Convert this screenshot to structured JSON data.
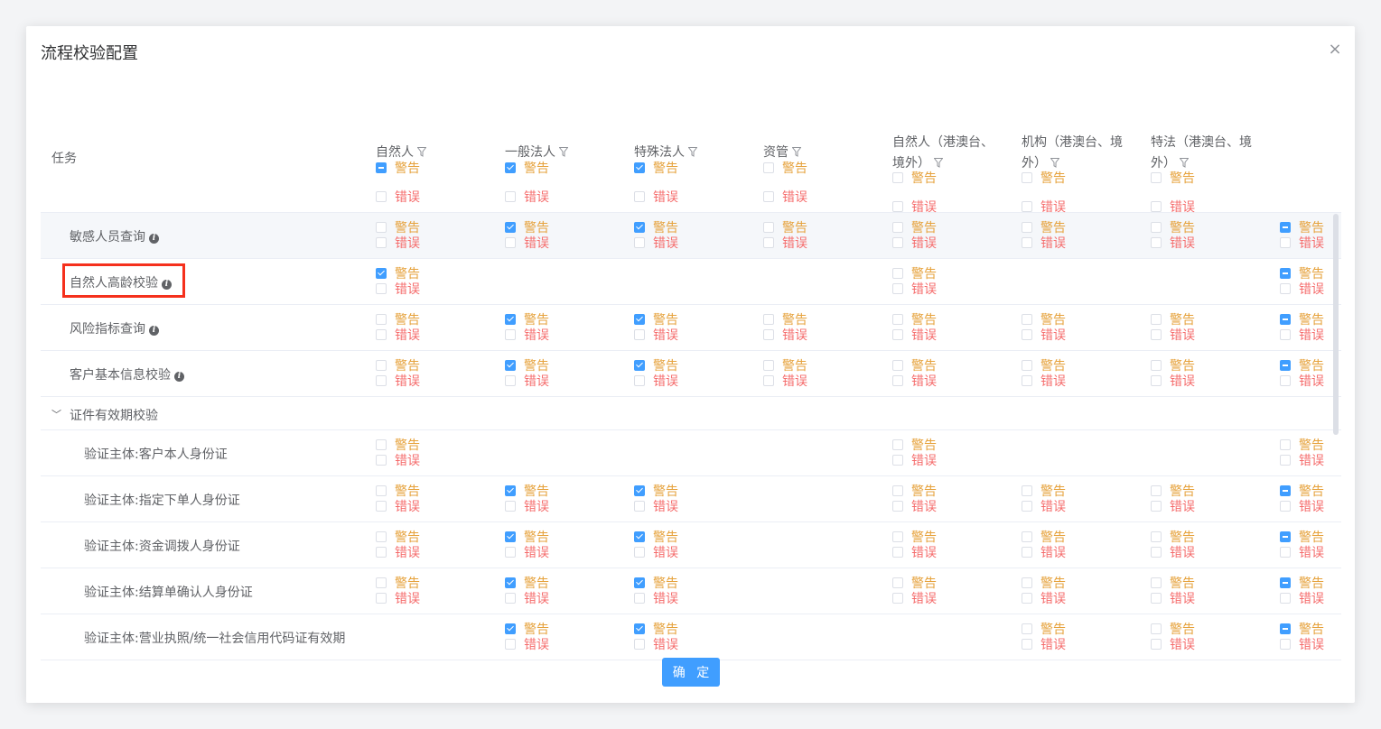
{
  "dialog": {
    "title": "流程校验配置",
    "close_symbol": "×",
    "confirm_label": "确 定"
  },
  "header": {
    "task_label": "任务",
    "columns": [
      {
        "title_lines": [
          "自然人"
        ],
        "warn_state": "indeterminate",
        "error_state": "unchecked"
      },
      {
        "title_lines": [
          "一般法人"
        ],
        "warn_state": "checked",
        "error_state": "unchecked"
      },
      {
        "title_lines": [
          "特殊法人"
        ],
        "warn_state": "checked",
        "error_state": "unchecked"
      },
      {
        "title_lines": [
          "资管"
        ],
        "warn_state": "unchecked",
        "error_state": "unchecked"
      },
      {
        "title_lines": [
          "自然人（港澳台、",
          "境外）"
        ],
        "warn_state": "unchecked",
        "error_state": "unchecked"
      },
      {
        "title_lines": [
          "机构（港澳台、境",
          "外）"
        ],
        "warn_state": "unchecked",
        "error_state": "unchecked"
      },
      {
        "title_lines": [
          "特法（港澳台、境",
          "外）"
        ],
        "warn_state": "unchecked",
        "error_state": "unchecked"
      }
    ]
  },
  "labels": {
    "warn": "警告",
    "error": "错误"
  },
  "rows": [
    {
      "name": "敏感人员查询",
      "info": true,
      "level": 1,
      "highlighted_bg": true,
      "cells": [
        {
          "w": "u",
          "e": "u"
        },
        {
          "w": "c",
          "e": "u"
        },
        {
          "w": "c",
          "e": "u"
        },
        {
          "w": "u",
          "e": "u"
        },
        {
          "w": "u",
          "e": "u"
        },
        {
          "w": "u",
          "e": "u"
        },
        {
          "w": "u",
          "e": "u"
        },
        {
          "w": "i",
          "e": "u"
        }
      ]
    },
    {
      "name": "自然人高龄校验",
      "info": true,
      "level": 1,
      "marked": true,
      "cells": [
        {
          "w": "c",
          "e": "u"
        },
        null,
        null,
        null,
        {
          "w": "u",
          "e": "u"
        },
        null,
        null,
        {
          "w": "i",
          "e": "u"
        }
      ]
    },
    {
      "name": "风险指标查询",
      "info": true,
      "level": 1,
      "cells": [
        {
          "w": "u",
          "e": "u"
        },
        {
          "w": "c",
          "e": "u"
        },
        {
          "w": "c",
          "e": "u"
        },
        {
          "w": "u",
          "e": "u"
        },
        {
          "w": "u",
          "e": "u"
        },
        {
          "w": "u",
          "e": "u"
        },
        {
          "w": "u",
          "e": "u"
        },
        {
          "w": "i",
          "e": "u"
        }
      ]
    },
    {
      "name": "客户基本信息校验",
      "info": true,
      "level": 1,
      "cells": [
        {
          "w": "u",
          "e": "u"
        },
        {
          "w": "c",
          "e": "u"
        },
        {
          "w": "c",
          "e": "u"
        },
        {
          "w": "u",
          "e": "u"
        },
        {
          "w": "u",
          "e": "u"
        },
        {
          "w": "u",
          "e": "u"
        },
        {
          "w": "u",
          "e": "u"
        },
        {
          "w": "i",
          "e": "u"
        }
      ]
    },
    {
      "name": "证件有效期校验",
      "group": true,
      "expanded_symbol": "﹀"
    },
    {
      "name": "验证主体:客户本人身份证",
      "level": 2,
      "cells": [
        {
          "w": "u",
          "e": "u"
        },
        null,
        null,
        null,
        {
          "w": "u",
          "e": "u"
        },
        null,
        null,
        {
          "w": "u",
          "e": "u"
        }
      ]
    },
    {
      "name": "验证主体:指定下单人身份证",
      "level": 2,
      "cells": [
        {
          "w": "u",
          "e": "u"
        },
        {
          "w": "c",
          "e": "u"
        },
        {
          "w": "c",
          "e": "u"
        },
        null,
        {
          "w": "u",
          "e": "u"
        },
        {
          "w": "u",
          "e": "u"
        },
        {
          "w": "u",
          "e": "u"
        },
        {
          "w": "i",
          "e": "u"
        }
      ]
    },
    {
      "name": "验证主体:资金调拨人身份证",
      "level": 2,
      "cells": [
        {
          "w": "u",
          "e": "u"
        },
        {
          "w": "c",
          "e": "u"
        },
        {
          "w": "c",
          "e": "u"
        },
        null,
        {
          "w": "u",
          "e": "u"
        },
        {
          "w": "u",
          "e": "u"
        },
        {
          "w": "u",
          "e": "u"
        },
        {
          "w": "i",
          "e": "u"
        }
      ]
    },
    {
      "name": "验证主体:结算单确认人身份证",
      "level": 2,
      "cells": [
        {
          "w": "u",
          "e": "u"
        },
        {
          "w": "c",
          "e": "u"
        },
        {
          "w": "c",
          "e": "u"
        },
        null,
        {
          "w": "u",
          "e": "u"
        },
        {
          "w": "u",
          "e": "u"
        },
        {
          "w": "u",
          "e": "u"
        },
        {
          "w": "i",
          "e": "u"
        }
      ]
    },
    {
      "name": "验证主体:营业执照/统一社会信用代码证有效期",
      "level": 2,
      "cells": [
        null,
        {
          "w": "c",
          "e": "u"
        },
        {
          "w": "c",
          "e": "u"
        },
        null,
        null,
        {
          "w": "u",
          "e": "u"
        },
        {
          "w": "u",
          "e": "u"
        },
        {
          "w": "i",
          "e": "u"
        }
      ]
    }
  ],
  "colors": {
    "primary": "#409eff",
    "warn": "#e6a23c",
    "error": "#f56c6c",
    "mark": "#f5301c"
  }
}
